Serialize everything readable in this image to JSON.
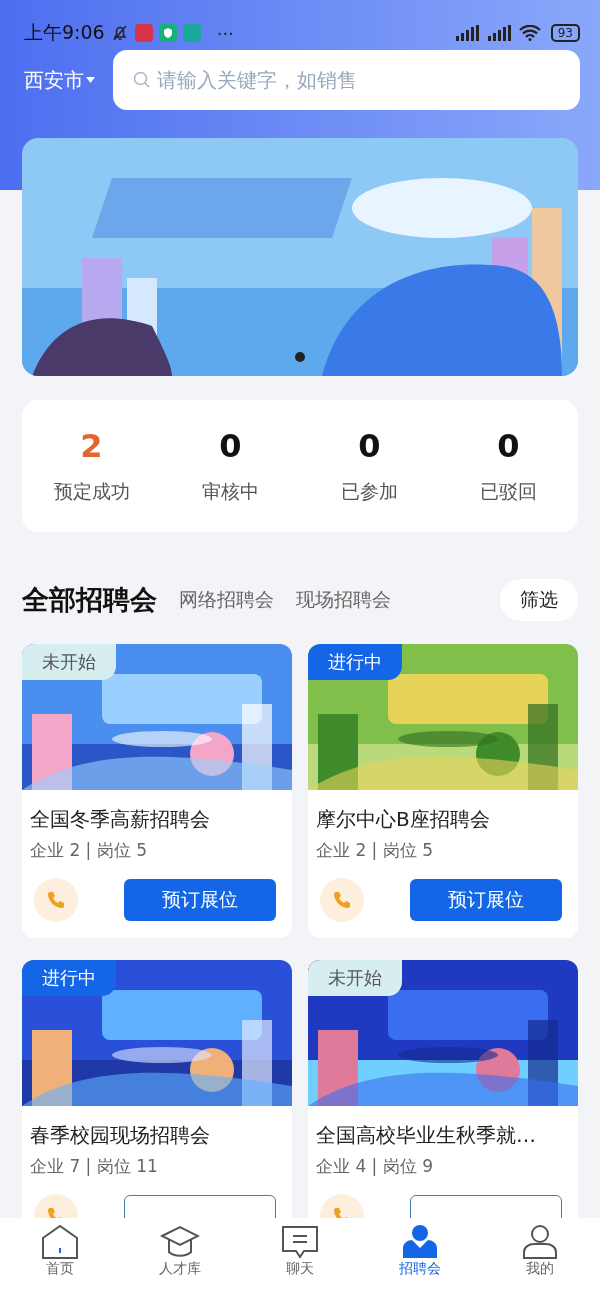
{
  "status_bar": {
    "time": "上午9:06",
    "more": "···",
    "battery": "93"
  },
  "header": {
    "city": "西安市",
    "search": {
      "placeholder": "请输入关键字，如销售"
    }
  },
  "banner": {
    "pages": [
      {
        "selected": true
      }
    ]
  },
  "stats": [
    {
      "value": "2",
      "label": "预定成功",
      "highlight": true
    },
    {
      "value": "0",
      "label": "审核中",
      "highlight": false
    },
    {
      "value": "0",
      "label": "已参加",
      "highlight": false
    },
    {
      "value": "0",
      "label": "已驳回",
      "highlight": false
    }
  ],
  "fair_tabs": [
    {
      "label": "全部招聘会",
      "selected": true
    },
    {
      "label": "网络招聘会",
      "selected": false
    },
    {
      "label": "现场招聘会",
      "selected": false
    }
  ],
  "filter_button": "筛选",
  "fairs": [
    {
      "status": "未开始",
      "kind": "upcoming",
      "title": "全国冬季高薪招聘会",
      "stats": "企业 2 | 岗位 5",
      "button": "预订展位"
    },
    {
      "status": "进行中",
      "kind": "ongoing",
      "title": "摩尔中心B座招聘会",
      "stats": "企业 2 | 岗位 5",
      "button": "预订展位"
    },
    {
      "status": "进行中",
      "kind": "ongoing",
      "title": "春季校园现场招聘会",
      "stats": "企业 7 | 岗位 11"
    },
    {
      "status": "未开始",
      "kind": "upcoming",
      "title": "全国高校毕业生秋季就…",
      "stats": "企业 4 | 岗位 9"
    }
  ],
  "bottom_nav": [
    {
      "label": "首页",
      "selected": false
    },
    {
      "label": "人才库",
      "selected": false
    },
    {
      "label": "聊天",
      "selected": false
    },
    {
      "label": "招聘会",
      "selected": true
    },
    {
      "label": "我的",
      "selected": false
    }
  ]
}
